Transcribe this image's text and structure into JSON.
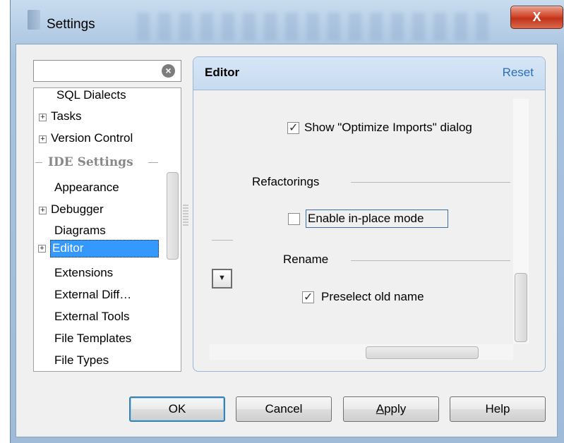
{
  "window": {
    "title": "Settings",
    "close_glyph": "X"
  },
  "search": {
    "value": "",
    "placeholder": "",
    "clear_icon": "clear-circle-icon"
  },
  "tree": {
    "items": [
      {
        "label": "SQL Dialects",
        "expandable": false
      },
      {
        "label": "Tasks",
        "expandable": true
      },
      {
        "label": "Version Control",
        "expandable": true
      },
      {
        "label": "IDE Settings",
        "group": true
      },
      {
        "label": "Appearance",
        "expandable": false
      },
      {
        "label": "Debugger",
        "expandable": true
      },
      {
        "label": "Diagrams",
        "expandable": false
      },
      {
        "label": "Editor",
        "expandable": true,
        "selected": true
      },
      {
        "label": "Extensions",
        "expandable": false
      },
      {
        "label": "External Diff…",
        "expandable": false
      },
      {
        "label": "External Tools",
        "expandable": false
      },
      {
        "label": "File Templates",
        "expandable": false
      },
      {
        "label": "File Types",
        "expandable": false
      }
    ],
    "expander_glyph": "+"
  },
  "editor_panel": {
    "title": "Editor",
    "reset_label": "Reset",
    "show_optimize_imports": {
      "label": "Show \"Optimize Imports\" dialog",
      "checked": true
    },
    "refactorings_header": "Refactorings",
    "enable_inplace": {
      "label": "Enable in-place mode",
      "checked": false
    },
    "rename_header": "Rename",
    "preselect_old_name": {
      "label": "Preselect old name",
      "checked": true
    },
    "dropdown_glyph": "▼"
  },
  "buttons": {
    "ok": "OK",
    "cancel": "Cancel",
    "apply_first": "A",
    "apply_rest": "pply",
    "help": "Help"
  },
  "colors": {
    "selection": "#3399ff",
    "header_bg": "#c7dbf1",
    "link": "#2b6fb6",
    "close_red": "#c0321b"
  }
}
